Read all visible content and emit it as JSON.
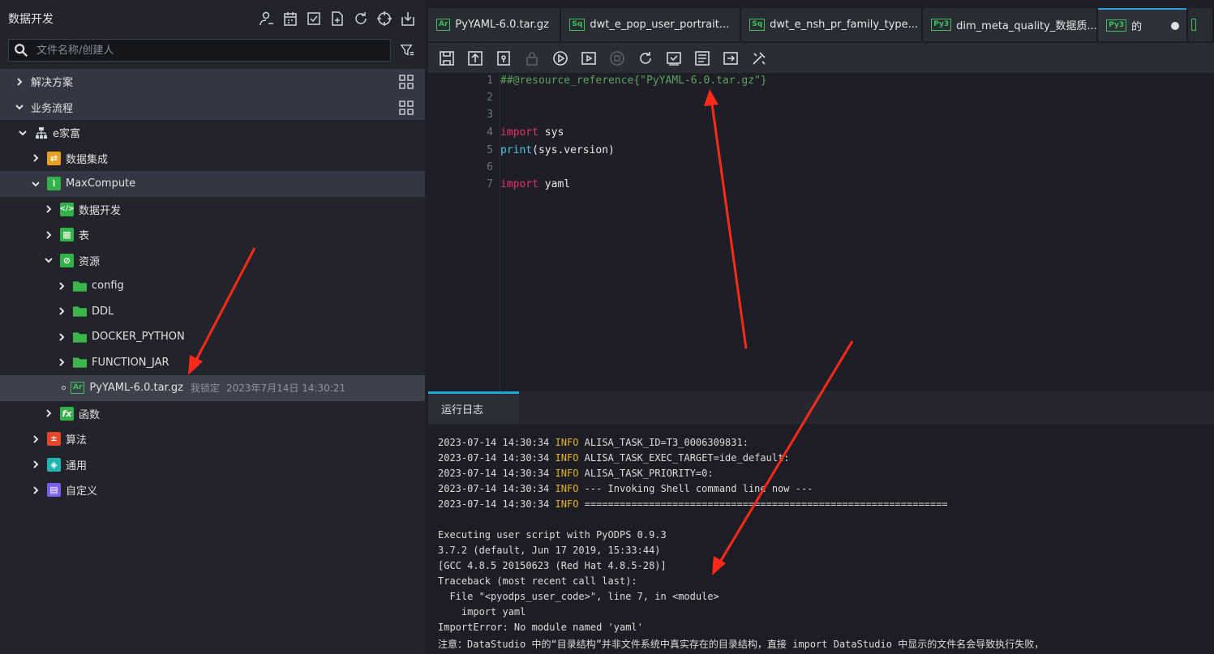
{
  "sidebar": {
    "title": "数据开发",
    "search_placeholder": "文件名称/创建人",
    "header_icons": [
      "user-icon",
      "calendar-icon",
      "checklist-icon",
      "new-file-icon",
      "refresh-icon",
      "locate-icon",
      "import-icon"
    ],
    "tree": {
      "solutions": "解决方案",
      "business_flow": "业务流程",
      "efamily": "e家富",
      "data_integration": "数据集成",
      "maxcompute": "MaxCompute",
      "data_dev": "数据开发",
      "table": "表",
      "resources": "资源",
      "folders": [
        "config",
        "DDL",
        "DOCKER_PYTHON",
        "FUNCTION_JAR"
      ],
      "resource_file": {
        "badge": "Ar",
        "name": "PyYAML-6.0.tar.gz",
        "lock": "我锁定",
        "time": "2023年7月14日 14:30:21"
      },
      "functions": "函数",
      "algorithm": "算法",
      "common": "通用",
      "custom": "自定义"
    }
  },
  "tabs": [
    {
      "badge": "Ar",
      "label": "PyYAML-6.0.tar.gz"
    },
    {
      "badge": "Sq",
      "label": "dwt_e_pop_user_portrait..."
    },
    {
      "badge": "Sq",
      "label": "dwt_e_nsh_pr_family_type..."
    },
    {
      "badge": "Py3",
      "label": "dim_meta_quality_数据质..."
    },
    {
      "badge": "Py3",
      "label": "的"
    }
  ],
  "editor": {
    "lines": [
      "1",
      "2",
      "3",
      "4",
      "5",
      "6",
      "7"
    ],
    "code": {
      "line1": "##@resource_reference{\"PyYAML-6.0.tar.gz\"}",
      "line4_kw": "import",
      "line4_rest": " sys",
      "line5_fn": "print",
      "line5_rest": "(sys.version)",
      "line7_kw": "import",
      "line7_rest": " yaml"
    }
  },
  "log": {
    "tab_label": "运行日志",
    "info_lines": [
      {
        "ts": "2023-07-14 14:30:34",
        "level": "INFO",
        "msg": "ALISA_TASK_ID=T3_0006309831:"
      },
      {
        "ts": "2023-07-14 14:30:34",
        "level": "INFO",
        "msg": "ALISA_TASK_EXEC_TARGET=ide_default:"
      },
      {
        "ts": "2023-07-14 14:30:34",
        "level": "INFO",
        "msg": "ALISA_TASK_PRIORITY=0:"
      },
      {
        "ts": "2023-07-14 14:30:34",
        "level": "INFO",
        "msg": "--- Invoking Shell command line now ---"
      },
      {
        "ts": "2023-07-14 14:30:34",
        "level": "INFO",
        "msg": "=============================================================="
      }
    ],
    "plain_lines": [
      "Executing user script with PyODPS 0.9.3",
      "3.7.2 (default, Jun 17 2019, 15:33:44)",
      "[GCC 4.8.5 20150623 (Red Hat 4.8.5-28)]",
      "Traceback (most recent call last):",
      "  File \"<pyodps_user_code>\", line 7, in <module>",
      "    import yaml",
      "ImportError: No module named 'yaml'",
      "注意：DataStudio 中的“目录结构”并非文件系统中真实存在的目录结构，直接 import DataStudio 中显示的文件名会导致执行失败，"
    ]
  },
  "colors": {
    "accent": "#22a3d9",
    "badge_green": "#3fbf5a",
    "arrow_red": "#ff2a1a",
    "info_yellow": "#e6b422"
  }
}
